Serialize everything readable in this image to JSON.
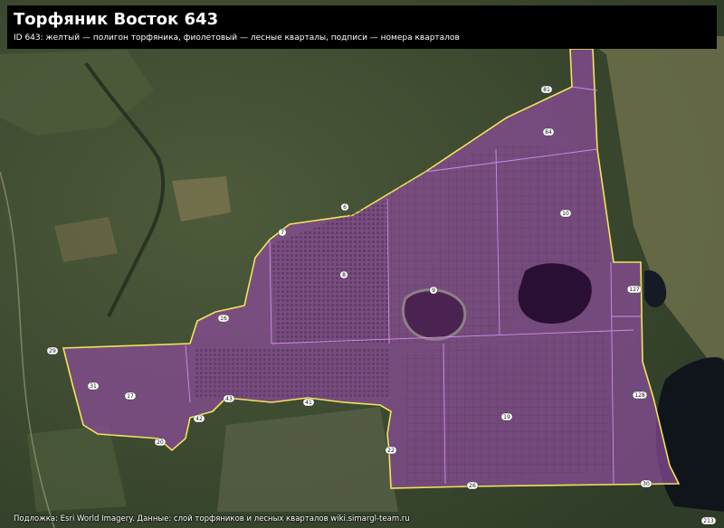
{
  "header": {
    "title": "Торфяник Восток 643",
    "subtitle": "ID 643: желтый — полигон торфяника, фиолетовый — лесные кварталы, подписи — номера кварталов"
  },
  "footer": {
    "attribution": "Подложка: Esri World Imagery. Данные: слой торфяников и лесных кварталов wiki.simargl-team.ru"
  },
  "legend_colors": {
    "peatland_outline": "#f2e45a",
    "forest_quarter": "#b070c8"
  },
  "quarter_labels": [
    {
      "id": "q-81",
      "text": "81"
    },
    {
      "id": "q-84",
      "text": "84"
    },
    {
      "id": "q-6",
      "text": "6"
    },
    {
      "id": "q-7",
      "text": "7"
    },
    {
      "id": "q-8",
      "text": "8"
    },
    {
      "id": "q-9",
      "text": "9"
    },
    {
      "id": "q-10",
      "text": "10"
    },
    {
      "id": "q-127",
      "text": "127"
    },
    {
      "id": "q-16",
      "text": "16"
    },
    {
      "id": "q-29",
      "text": "29"
    },
    {
      "id": "q-31",
      "text": "31"
    },
    {
      "id": "q-17",
      "text": "17"
    },
    {
      "id": "q-43",
      "text": "43"
    },
    {
      "id": "q-41",
      "text": "41"
    },
    {
      "id": "q-19",
      "text": "19"
    },
    {
      "id": "q-128",
      "text": "128"
    },
    {
      "id": "q-20",
      "text": "20"
    },
    {
      "id": "q-22",
      "text": "22"
    },
    {
      "id": "q-26",
      "text": "26"
    },
    {
      "id": "q-30",
      "text": "30"
    },
    {
      "id": "q-42",
      "text": "42"
    }
  ],
  "corner_label": "213"
}
